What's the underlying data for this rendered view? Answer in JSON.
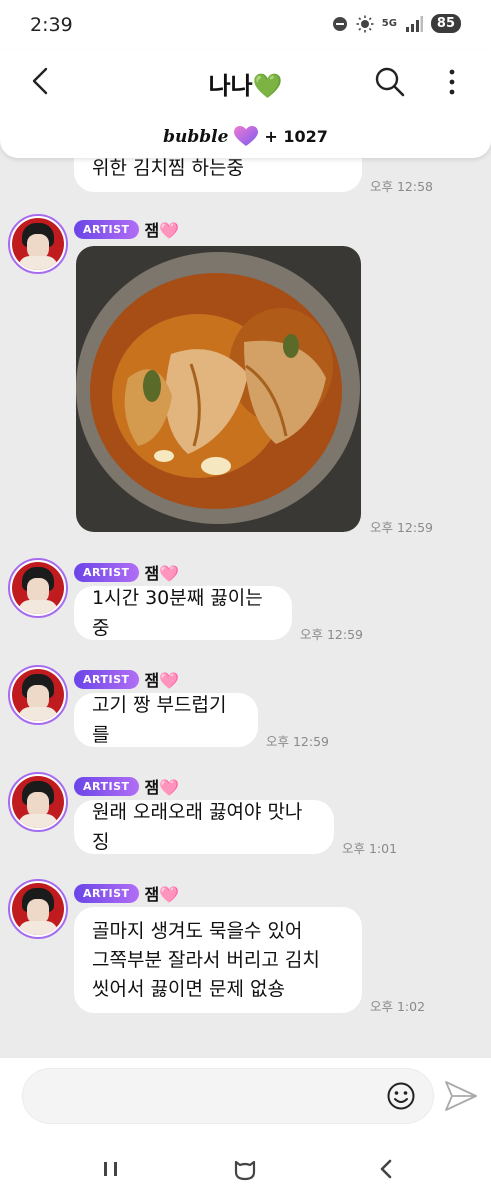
{
  "status_bar": {
    "time": "2:39",
    "network": "5G",
    "battery": "85"
  },
  "header": {
    "title": "나나💚",
    "bubble_logo": "bubble",
    "bubble_count": "+ 1027"
  },
  "messages": [
    {
      "text": "위한 김치찜 하는중",
      "time": "오후 12:58"
    },
    {
      "sender_badge": "ARTIST",
      "sender_name": "잼🩷",
      "photo": "kimchi-jjim-pot",
      "time": "오후 12:59"
    },
    {
      "sender_badge": "ARTIST",
      "sender_name": "잼🩷",
      "text": "1시간 30분째 끓이는중",
      "time": "오후 12:59"
    },
    {
      "sender_badge": "ARTIST",
      "sender_name": "잼🩷",
      "text": "고기 짱 부드럽기를",
      "time": "오후 12:59"
    },
    {
      "sender_badge": "ARTIST",
      "sender_name": "잼🩷",
      "text": "원래 오래오래 끓여야 맛나징",
      "time": "오후 1:01"
    },
    {
      "sender_badge": "ARTIST",
      "sender_name": "잼🩷",
      "lines": [
        "골마지 생겨도 묵을수 있어",
        "그쪽부분 잘라서 버리고 김치",
        "씻어서 끓이면 문제 없숑"
      ],
      "time": "오후 1:02"
    }
  ],
  "icons": {
    "back": "back-arrow-icon",
    "search": "search-icon",
    "more": "more-vertical-icon",
    "emoji": "smiley-icon",
    "send": "send-icon",
    "nav_recents": "recents-icon",
    "nav_home": "home-icon",
    "nav_back": "back-icon"
  },
  "colors": {
    "accent": "#8e5cf0",
    "background": "#ebebeb",
    "bubble": "#ffffff"
  }
}
